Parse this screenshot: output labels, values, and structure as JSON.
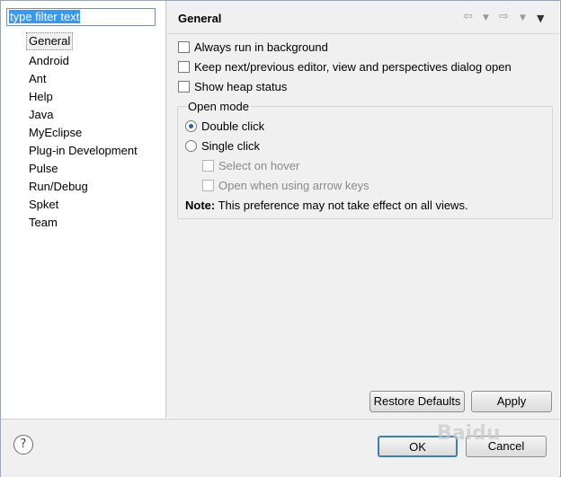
{
  "filter": {
    "value": "type filter text"
  },
  "tree": {
    "items": [
      "General",
      "Android",
      "Ant",
      "Help",
      "Java",
      "MyEclipse",
      "Plug-in Development",
      "Pulse",
      "Run/Debug",
      "Spket",
      "Team"
    ]
  },
  "header": {
    "title": "General"
  },
  "options": {
    "always_run": "Always run in background",
    "keep_next": "Keep next/previous editor, view and perspectives dialog open",
    "show_heap": "Show heap status"
  },
  "open_mode": {
    "title": "Open mode",
    "double": "Double click",
    "single": "Single click",
    "select_hover": "Select on hover",
    "open_arrow": "Open when using arrow keys",
    "note_label": "Note:",
    "note_text": "This preference may not take effect on all views."
  },
  "buttons": {
    "restore": "Restore Defaults",
    "apply": "Apply",
    "ok": "OK",
    "cancel": "Cancel"
  },
  "watermark": "Baidu"
}
